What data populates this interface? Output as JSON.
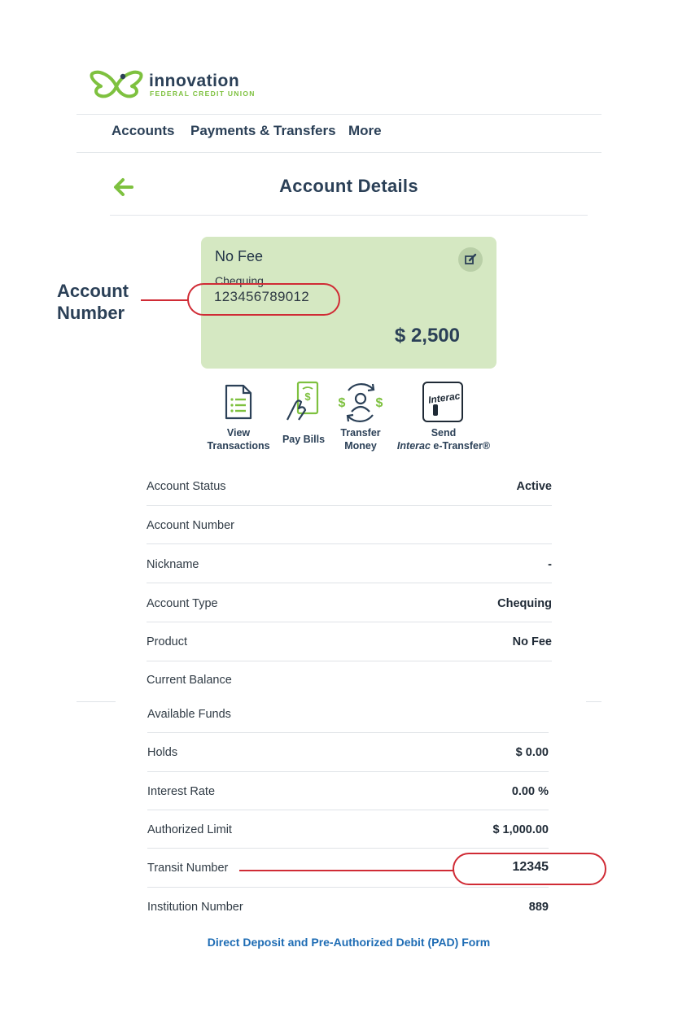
{
  "brand": {
    "name": "innovation",
    "subtitle": "FEDERAL CREDIT UNION",
    "primary_color": "#2b4057",
    "accent_color": "#7ec13f"
  },
  "nav": {
    "items": [
      {
        "label": "Accounts"
      },
      {
        "label": "Payments & Transfers"
      },
      {
        "label": "More"
      }
    ]
  },
  "header": {
    "title": "Account Details",
    "back_icon": "arrow-left-icon"
  },
  "card": {
    "name": "No Fee",
    "type": "Chequing",
    "number": "123456789012",
    "balance": "$ 2,500",
    "edit_icon": "edit-icon",
    "background_color": "#d5e8c2"
  },
  "annotations": {
    "account_number_label_line1": "Account",
    "account_number_label_line2": "Number",
    "highlight_color": "#d02b35"
  },
  "actions": [
    {
      "line1": "View",
      "line2": "Transactions",
      "icon": "document-list-icon"
    },
    {
      "line1": "Pay Bills",
      "line2": "",
      "icon": "pay-bills-icon"
    },
    {
      "line1": "Transfer",
      "line2": "Money",
      "icon": "transfer-money-icon"
    },
    {
      "line1": "Send",
      "line2_italic": "Interac",
      "line2_rest": " e-Transfer®",
      "icon": "interac-icon",
      "icon_text": "Interac"
    }
  ],
  "details": [
    {
      "label": "Account Status",
      "value": "Active"
    },
    {
      "label": "Account Number",
      "value": ""
    },
    {
      "label": "Nickname",
      "value": "-"
    },
    {
      "label": "Account Type",
      "value": "Chequing"
    },
    {
      "label": "Product",
      "value": "No Fee"
    },
    {
      "label": "Current Balance",
      "value": ""
    }
  ],
  "details2": [
    {
      "label": "Available Funds",
      "value": ""
    },
    {
      "label": "Holds",
      "value": "$ 0.00"
    },
    {
      "label": "Interest Rate",
      "value": "0.00 %"
    },
    {
      "label": "Authorized Limit",
      "value": "$ 1,000.00"
    },
    {
      "label": "Transit Number",
      "value": "12345"
    },
    {
      "label": "Institution Number",
      "value": "889"
    }
  ],
  "footer": {
    "pad_link": "Direct Deposit and Pre-Authorized Debit (PAD) Form"
  }
}
